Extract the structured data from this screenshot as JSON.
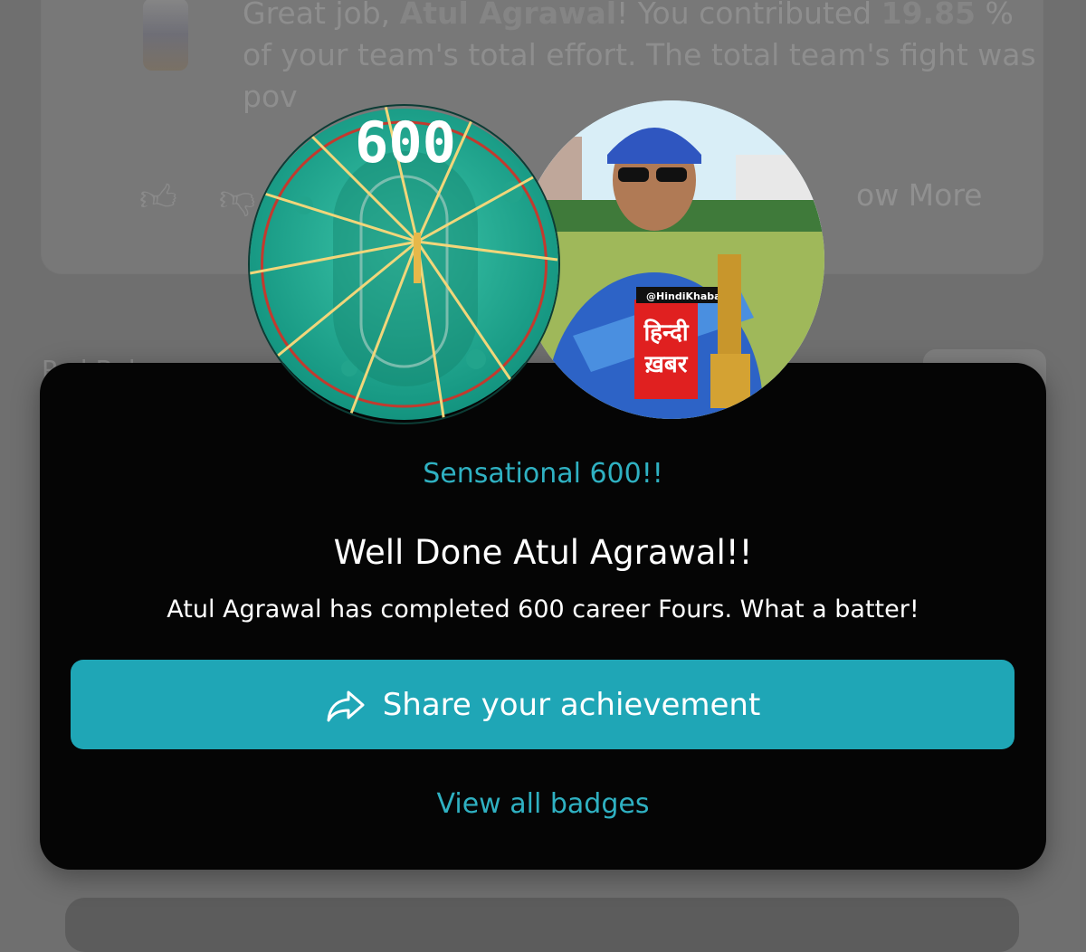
{
  "background_feed": {
    "text_prefix": "Great job, ",
    "name": "Atul Agrawal",
    "text_mid": "! You contributed ",
    "percentage": "19.85",
    "text_after_pct": " % of your team's total effort. The total team's fight was pov",
    "show_more_label": "ow More",
    "section_label": "Pad Bal"
  },
  "badge": {
    "milestone_text": "600",
    "name": "Sensational 600!!"
  },
  "modal": {
    "headline": "Well Done Atul Agrawal!!",
    "message": "Atul Agrawal has completed 600 career Fours. What a batter!",
    "share_label": "Share your achievement",
    "view_all_label": "View all badges"
  },
  "player_photo": {
    "handle": "@HindiKhabar",
    "shirt_text_line1": "हिन्दी",
    "shirt_text_line2": "ख़बर"
  },
  "colors": {
    "accent": "#1fa6b6",
    "accent_text": "#2fb1c2",
    "modal_bg": "#050505",
    "badge_green": "#1aa38a"
  },
  "icons": {
    "share": "share-icon",
    "like": "thumbs-up-icon",
    "dislike": "thumbs-down-icon"
  }
}
